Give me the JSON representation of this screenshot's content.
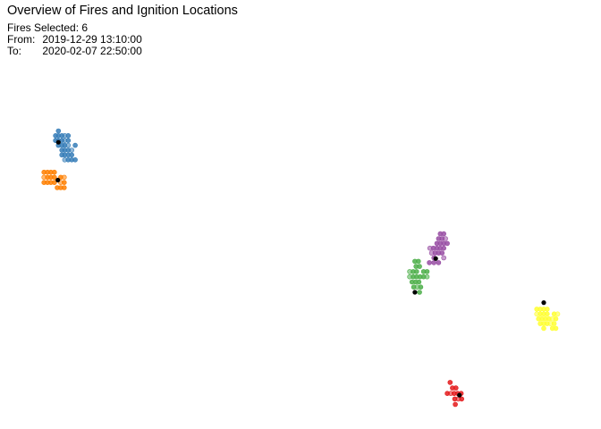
{
  "header": {
    "title": "Overview of Fires and Ignition Locations",
    "selected_label": "Fires Selected:",
    "selected_count": "6",
    "from_label": "From:",
    "from_value": "2019-12-29 13:10:00",
    "to_label": "To:",
    "to_value": "2020-02-07 22:50:00"
  },
  "chart_data": {
    "type": "scatter",
    "grid": false,
    "legend": "none",
    "xlim": [
      0,
      100
    ],
    "ylim": [
      0,
      100
    ],
    "ignition_color": "#000000",
    "series": [
      {
        "color": "#377eb8",
        "ignition": [
          8.1,
          78.4
        ],
        "points": [
          [
            8.1,
            81.7
          ],
          [
            7.6,
            80.3
          ],
          [
            8.1,
            80.3
          ],
          [
            8.7,
            80.3
          ],
          [
            9.2,
            80.3
          ],
          [
            9.8,
            80.3
          ],
          [
            7.6,
            78.9
          ],
          [
            8.1,
            78.9
          ],
          [
            8.7,
            78.9
          ],
          [
            9.2,
            78.9
          ],
          [
            9.8,
            78.9
          ],
          [
            8.1,
            77.5
          ],
          [
            8.7,
            77.5
          ],
          [
            9.2,
            77.5
          ],
          [
            9.8,
            77.5
          ],
          [
            11.0,
            77.5
          ],
          [
            8.7,
            76.1
          ],
          [
            9.2,
            76.1
          ],
          [
            9.8,
            76.1
          ],
          [
            10.4,
            76.1
          ],
          [
            8.7,
            74.7
          ],
          [
            9.2,
            74.7
          ],
          [
            9.8,
            74.7
          ],
          [
            10.4,
            74.7
          ],
          [
            9.2,
            73.3
          ],
          [
            9.8,
            73.3
          ],
          [
            10.4,
            73.3
          ],
          [
            11.0,
            73.3
          ]
        ]
      },
      {
        "color": "#ff7f00",
        "ignition": [
          8.0,
          67.4
        ],
        "points": [
          [
            5.6,
            69.7
          ],
          [
            6.2,
            69.7
          ],
          [
            6.8,
            69.7
          ],
          [
            7.4,
            69.7
          ],
          [
            5.6,
            68.2
          ],
          [
            6.2,
            68.2
          ],
          [
            6.8,
            68.2
          ],
          [
            7.4,
            68.2
          ],
          [
            8.5,
            68.2
          ],
          [
            9.1,
            68.2
          ],
          [
            5.6,
            66.7
          ],
          [
            6.2,
            66.7
          ],
          [
            6.8,
            66.7
          ],
          [
            7.4,
            66.7
          ],
          [
            8.5,
            66.7
          ],
          [
            9.1,
            66.7
          ],
          [
            7.9,
            65.2
          ],
          [
            8.5,
            65.2
          ],
          [
            9.1,
            65.2
          ]
        ]
      },
      {
        "color": "#984ea3",
        "ignition": [
          73.4,
          44.6
        ],
        "points": [
          [
            74.2,
            51.8
          ],
          [
            74.8,
            51.8
          ],
          [
            73.9,
            50.4
          ],
          [
            74.5,
            50.4
          ],
          [
            75.1,
            50.4
          ],
          [
            73.6,
            49.0
          ],
          [
            74.2,
            49.0
          ],
          [
            74.8,
            49.0
          ],
          [
            75.4,
            49.0
          ],
          [
            72.4,
            47.6
          ],
          [
            73.0,
            47.6
          ],
          [
            73.6,
            47.6
          ],
          [
            74.2,
            47.6
          ],
          [
            74.8,
            47.6
          ],
          [
            72.7,
            46.2
          ],
          [
            73.3,
            46.2
          ],
          [
            73.9,
            46.2
          ],
          [
            74.5,
            46.2
          ],
          [
            73.1,
            44.8
          ],
          [
            74.8,
            44.8
          ],
          [
            72.3,
            43.4
          ],
          [
            73.1,
            43.4
          ],
          [
            73.9,
            43.4
          ]
        ]
      },
      {
        "color": "#4daf4a",
        "ignition": [
          69.8,
          34.8
        ],
        "points": [
          [
            69.8,
            43.8
          ],
          [
            70.4,
            43.8
          ],
          [
            70.0,
            42.3
          ],
          [
            70.6,
            42.3
          ],
          [
            68.9,
            40.8
          ],
          [
            69.5,
            40.8
          ],
          [
            70.1,
            40.8
          ],
          [
            71.3,
            40.8
          ],
          [
            71.9,
            40.8
          ],
          [
            68.9,
            39.3
          ],
          [
            69.5,
            39.3
          ],
          [
            70.1,
            39.3
          ],
          [
            70.7,
            39.3
          ],
          [
            71.3,
            39.3
          ],
          [
            71.9,
            39.3
          ],
          [
            69.3,
            37.8
          ],
          [
            69.9,
            37.8
          ],
          [
            70.5,
            37.8
          ],
          [
            69.6,
            36.3
          ],
          [
            70.2,
            36.3
          ],
          [
            70.8,
            36.3
          ],
          [
            70.6,
            34.8
          ]
        ]
      },
      {
        "color": "#ffff33",
        "ignition": [
          92.1,
          31.8
        ],
        "points": [
          [
            90.9,
            29.9
          ],
          [
            91.5,
            29.9
          ],
          [
            92.1,
            29.9
          ],
          [
            92.7,
            29.9
          ],
          [
            90.9,
            28.5
          ],
          [
            91.5,
            28.5
          ],
          [
            92.1,
            28.5
          ],
          [
            92.7,
            28.5
          ],
          [
            93.9,
            28.5
          ],
          [
            94.5,
            28.5
          ],
          [
            91.2,
            27.1
          ],
          [
            91.8,
            27.1
          ],
          [
            92.4,
            27.1
          ],
          [
            93.0,
            27.1
          ],
          [
            93.6,
            27.1
          ],
          [
            94.2,
            27.1
          ],
          [
            91.5,
            25.7
          ],
          [
            92.1,
            25.7
          ],
          [
            92.7,
            25.7
          ],
          [
            93.3,
            25.7
          ],
          [
            93.9,
            25.7
          ],
          [
            92.1,
            24.3
          ],
          [
            93.6,
            24.3
          ],
          [
            94.2,
            24.3
          ]
        ]
      },
      {
        "color": "#e41a1c",
        "ignition": [
          77.5,
          4.9
        ],
        "points": [
          [
            75.9,
            8.6
          ],
          [
            76.3,
            7.0
          ],
          [
            76.9,
            7.0
          ],
          [
            75.4,
            5.4
          ],
          [
            76.0,
            5.4
          ],
          [
            76.6,
            5.4
          ],
          [
            77.2,
            5.4
          ],
          [
            77.8,
            5.4
          ],
          [
            76.7,
            3.8
          ],
          [
            77.3,
            3.8
          ],
          [
            77.9,
            3.8
          ],
          [
            76.8,
            2.2
          ]
        ]
      }
    ]
  }
}
